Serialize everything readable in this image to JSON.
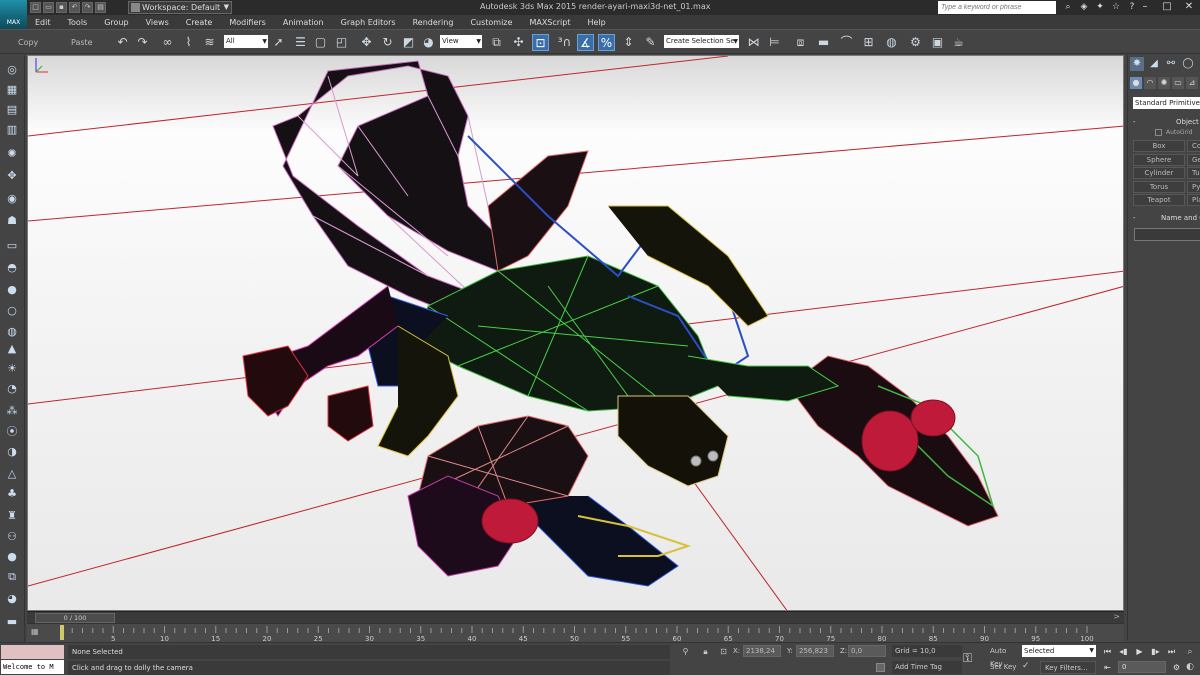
{
  "app": {
    "logo_text": "MAX",
    "window_title": "Autodesk 3ds Max  2015       render-ayari-maxi3d-net_01.max",
    "workspace_label": "Workspace: Default",
    "help_search_placeholder": "Type a keyword or phrase"
  },
  "menu": {
    "items": [
      "Edit",
      "Tools",
      "Group",
      "Views",
      "Create",
      "Modifiers",
      "Animation",
      "Graph Editors",
      "Rendering",
      "Customize",
      "MAXScript",
      "Help"
    ]
  },
  "toolbar": {
    "copy_label": "Copy",
    "paste_label": "Paste",
    "selection_filter": "All",
    "ref_coord_system": "View",
    "named_selection_placeholder": "Create Selection Se"
  },
  "command_panel": {
    "category": "Standard Primitives",
    "object_type_title": "Object Type",
    "autogrid_label": "AutoGrid",
    "primitives": [
      [
        "Box",
        "Cone"
      ],
      [
        "Sphere",
        "GeoSphere"
      ],
      [
        "Cylinder",
        "Tube"
      ],
      [
        "Torus",
        "Pyramid"
      ],
      [
        "Teapot",
        "Plane"
      ]
    ],
    "name_color_title": "Name and Color"
  },
  "timeline": {
    "slider_label": "0 / 100",
    "ticks": [
      "5",
      "10",
      "15",
      "20",
      "25",
      "30",
      "35",
      "40",
      "45",
      "50",
      "55",
      "60",
      "65",
      "70",
      "75",
      "80",
      "85",
      "90",
      "95",
      "100"
    ]
  },
  "status": {
    "maxscript_listener": "Welcome to M",
    "selection_text": "None Selected",
    "prompt_text": "Click and drag to dolly the camera",
    "x_label": "X:",
    "x_value": "2138,24",
    "y_label": "Y:",
    "y_value": "256,823",
    "z_label": "Z:",
    "z_value": "0,0",
    "grid_text": "Grid = 10,0",
    "add_time_tag": "Add Time Tag",
    "auto_key": "Auto Key",
    "set_key": "Set Key",
    "key_mode": "Selected",
    "key_filters": "Key Filters...",
    "current_frame": "0"
  }
}
